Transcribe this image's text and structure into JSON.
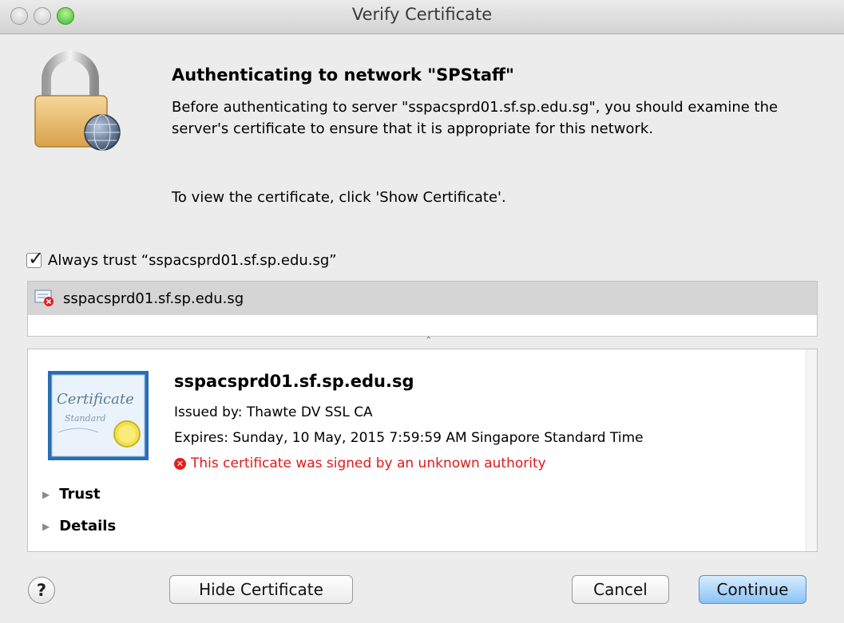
{
  "window": {
    "title": "Verify Certificate"
  },
  "message": {
    "heading": "Authenticating to network \"SPStaff\"",
    "body": "Before authenticating to server \"sspacsprd01.sf.sp.edu.sg\", you should examine the server's certificate to ensure that it is appropriate for this network.",
    "instruction": "To view the certificate, click 'Show Certificate'."
  },
  "trust_checkbox": {
    "label": "Always trust “sspacsprd01.sf.sp.edu.sg”",
    "checked": true
  },
  "cert_list": {
    "items": [
      {
        "label": "sspacsprd01.sf.sp.edu.sg"
      }
    ]
  },
  "cert_detail": {
    "name": "sspacsprd01.sf.sp.edu.sg",
    "issued_by": "Issued by: Thawte DV SSL CA",
    "expires": "Expires: Sunday, 10 May, 2015 7:59:59 AM Singapore Standard Time",
    "warning": "This certificate was signed by an unknown authority",
    "sections": [
      {
        "label": "Trust"
      },
      {
        "label": "Details"
      }
    ],
    "icon_text": [
      "Certificate",
      "Standard"
    ]
  },
  "buttons": {
    "help": "?",
    "hide_certificate": "Hide Certificate",
    "cancel": "Cancel",
    "continue": "Continue"
  },
  "colors": {
    "warning": "#e0191a",
    "default_button": "#8bc3f6",
    "selection": "#d5d5d5"
  }
}
